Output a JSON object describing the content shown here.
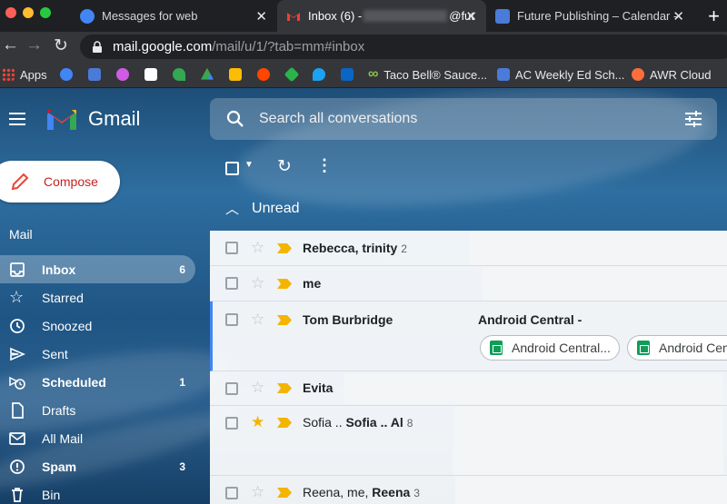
{
  "browser": {
    "tabs": [
      {
        "title": "Messages for web",
        "active": false
      },
      {
        "title": "Inbox (6) - ",
        "title_suffix": "@fut",
        "active": true
      },
      {
        "title": "Future Publishing – Calendar -",
        "active": false
      }
    ],
    "close_glyph": "✕",
    "new_tab_glyph": "+",
    "url_host": "mail.google.com",
    "url_path": "/mail/u/1/?tab=mm#inbox",
    "bookmarks": [
      {
        "label": "Apps",
        "icon": "apps-grid-icon"
      },
      {
        "label": "",
        "icon": "messages-icon",
        "color": "#4285f4"
      },
      {
        "label": "",
        "icon": "calendar-icon",
        "color": "#4a7bd8"
      },
      {
        "label": "",
        "icon": "globe-icon",
        "color": "#d05ce3"
      },
      {
        "label": "",
        "icon": "flipboard-icon",
        "color": "#ffffff"
      },
      {
        "label": "",
        "icon": "plant-icon",
        "color": "#34a853"
      },
      {
        "label": "",
        "icon": "drive-icon",
        "color": "#fbbc04"
      },
      {
        "label": "",
        "icon": "keep-icon",
        "color": "#fbbc04"
      },
      {
        "label": "",
        "icon": "reddit-icon",
        "color": "#ff4500"
      },
      {
        "label": "",
        "icon": "feedly-icon",
        "color": "#2bb24c"
      },
      {
        "label": "",
        "icon": "twitter-icon",
        "color": "#1da1f2"
      },
      {
        "label": "",
        "icon": "linkedin-icon",
        "color": "#0a66c2"
      },
      {
        "label": "Taco Bell® Sauce...",
        "icon": "infinity-icon",
        "color": "#8bc34a"
      },
      {
        "label": "AC Weekly Ed Sch...",
        "icon": "calendar-icon",
        "color": "#4a7bd8"
      },
      {
        "label": "AWR Cloud",
        "icon": "awr-icon",
        "color": "#ff6d3a"
      }
    ]
  },
  "gmail": {
    "brand": "Gmail",
    "search_placeholder": "Search all conversations",
    "compose_label": "Compose",
    "nav_heading": "Mail",
    "nav": [
      {
        "label": "Inbox",
        "count": "6",
        "icon": "inbox-icon",
        "active": true,
        "bold": true
      },
      {
        "label": "Starred",
        "count": "",
        "icon": "star-icon",
        "active": false,
        "bold": false
      },
      {
        "label": "Snoozed",
        "count": "",
        "icon": "clock-icon",
        "active": false,
        "bold": false
      },
      {
        "label": "Sent",
        "count": "",
        "icon": "send-icon",
        "active": false,
        "bold": false
      },
      {
        "label": "Scheduled",
        "count": "1",
        "icon": "scheduled-icon",
        "active": false,
        "bold": true
      },
      {
        "label": "Drafts",
        "count": "",
        "icon": "draft-icon",
        "active": false,
        "bold": false
      },
      {
        "label": "All Mail",
        "count": "",
        "icon": "all-mail-icon",
        "active": false,
        "bold": false
      },
      {
        "label": "Spam",
        "count": "3",
        "icon": "spam-icon",
        "active": false,
        "bold": true
      },
      {
        "label": "Bin",
        "count": "",
        "icon": "bin-icon",
        "active": false,
        "bold": false
      }
    ],
    "section_label": "Unread",
    "emails": [
      {
        "senders": [
          {
            "text": "Rebecca, trinity",
            "bold": true
          }
        ],
        "count": "2",
        "starred": false,
        "subject": "",
        "unread": true
      },
      {
        "senders": [
          {
            "text": "me",
            "bold": true
          }
        ],
        "count": "",
        "starred": false,
        "subject": "",
        "unread": true
      },
      {
        "senders": [
          {
            "text": "Tom Burbridge",
            "bold": true
          }
        ],
        "count": "",
        "starred": false,
        "subject": "Android Central -",
        "unread": true,
        "attachments": [
          "Android Central...",
          "Android Central..."
        ]
      },
      {
        "senders": [
          {
            "text": "Evita",
            "bold": true
          }
        ],
        "count": "",
        "starred": false,
        "subject": "",
        "unread": true
      },
      {
        "senders": [
          {
            "text": "Sofia .. ",
            "bold": false
          },
          {
            "text": "Sofia .. Al",
            "bold": true
          }
        ],
        "count": "8",
        "starred": true,
        "subject": "",
        "unread": true
      },
      {
        "senders": [
          {
            "text": "Reena, me, ",
            "bold": false
          },
          {
            "text": "Reena",
            "bold": true
          }
        ],
        "count": "3",
        "starred": false,
        "subject": "",
        "unread": true
      }
    ]
  }
}
